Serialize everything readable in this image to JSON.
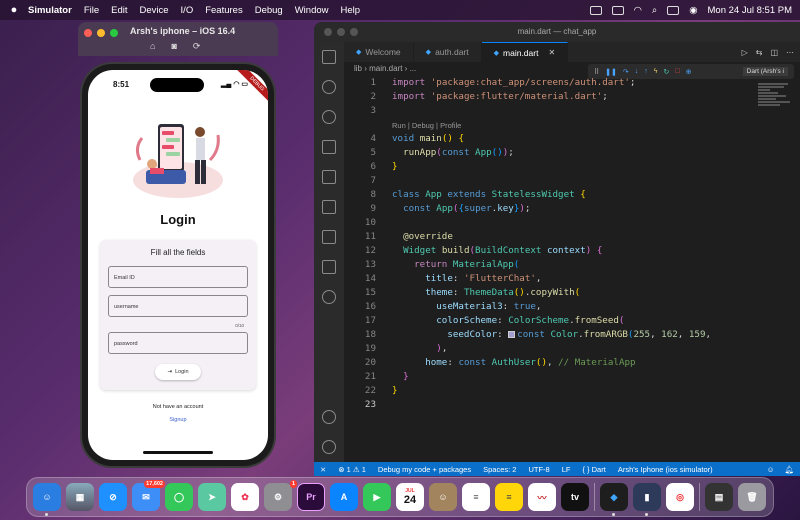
{
  "menubar": {
    "app": "Simulator",
    "items": [
      "File",
      "Edit",
      "Device",
      "I/O",
      "Features",
      "Debug",
      "Window",
      "Help"
    ],
    "clock": "Mon 24 Jul  8:51 PM"
  },
  "simulator": {
    "title": "Arsh's iphone – iOS 16.4"
  },
  "phone": {
    "time": "8:51",
    "ribbon": "DEBUG",
    "login_title": "Login",
    "card_subtitle": "Fill all the fields",
    "email_placeholder": "Email ID",
    "username_placeholder": "username",
    "username_counter": "0/10",
    "password_placeholder": "password",
    "login_button": "Login",
    "no_account": "Not have an account",
    "signup": "Signup"
  },
  "vscode": {
    "window_title": "main.dart — chat_app",
    "tabs": [
      {
        "label": "Welcome"
      },
      {
        "label": "auth.dart"
      },
      {
        "label": "main.dart"
      }
    ],
    "breadcrumb": "lib  ›  main.dart  ›  ...",
    "device_select": "Dart (Arsh's i",
    "codelens": "Run | Debug | Profile",
    "status": {
      "errors": "⊗ 1 ⚠ 1",
      "debug": "Debug my code + packages",
      "spaces": "Spaces: 2",
      "encoding": "UTF-8",
      "eol": "LF",
      "lang": "{ }  Dart",
      "device": "Arsh's Iphone (ios simulator)"
    }
  },
  "dock": {
    "mail_badge": "17,602",
    "settings_badge": "1",
    "calendar_month": "JUL",
    "calendar_day": "24"
  }
}
